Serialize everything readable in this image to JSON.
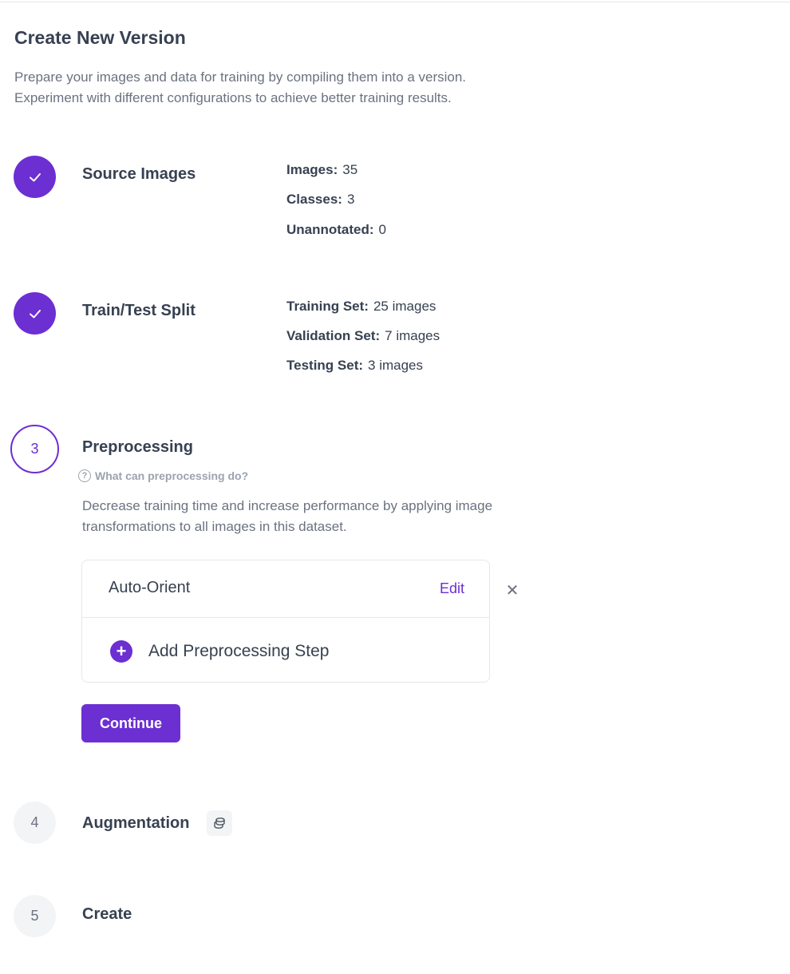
{
  "page": {
    "title": "Create New Version",
    "intro_line1": "Prepare your images and data for training by compiling them into a version.",
    "intro_line2": "Experiment with different configurations to achieve better training results."
  },
  "colors": {
    "accent": "#6c2fd2",
    "text": "#374151",
    "muted": "#6b7280",
    "pending_bg": "#f3f4f6"
  },
  "steps": [
    {
      "title": "Source Images",
      "status": "done",
      "icon": "check-icon",
      "stats": [
        {
          "label": "Images:",
          "value": "35"
        },
        {
          "label": "Classes:",
          "value": "3"
        },
        {
          "label": "Unannotated:",
          "value": "0"
        }
      ]
    },
    {
      "title": "Train/Test Split",
      "status": "done",
      "icon": "check-icon",
      "stats": [
        {
          "label": "Training Set:",
          "value": "25 images"
        },
        {
          "label": "Validation Set:",
          "value": "7 images"
        },
        {
          "label": "Testing Set:",
          "value": "3 images"
        }
      ]
    },
    {
      "number": "3",
      "title": "Preprocessing",
      "status": "active",
      "help_link": "What can preprocessing do?",
      "description_line1": "Decrease training time and increase performance by applying image",
      "description_line2": "transformations to all images in this dataset.",
      "applied_steps": [
        {
          "name": "Auto-Orient",
          "edit_label": "Edit",
          "remove_icon": "close-icon"
        }
      ],
      "add_step_label": "Add Preprocessing Step",
      "continue_label": "Continue"
    },
    {
      "number": "4",
      "title": "Augmentation",
      "status": "pending",
      "badge_icon": "coins-icon"
    },
    {
      "number": "5",
      "title": "Create",
      "status": "pending"
    }
  ]
}
